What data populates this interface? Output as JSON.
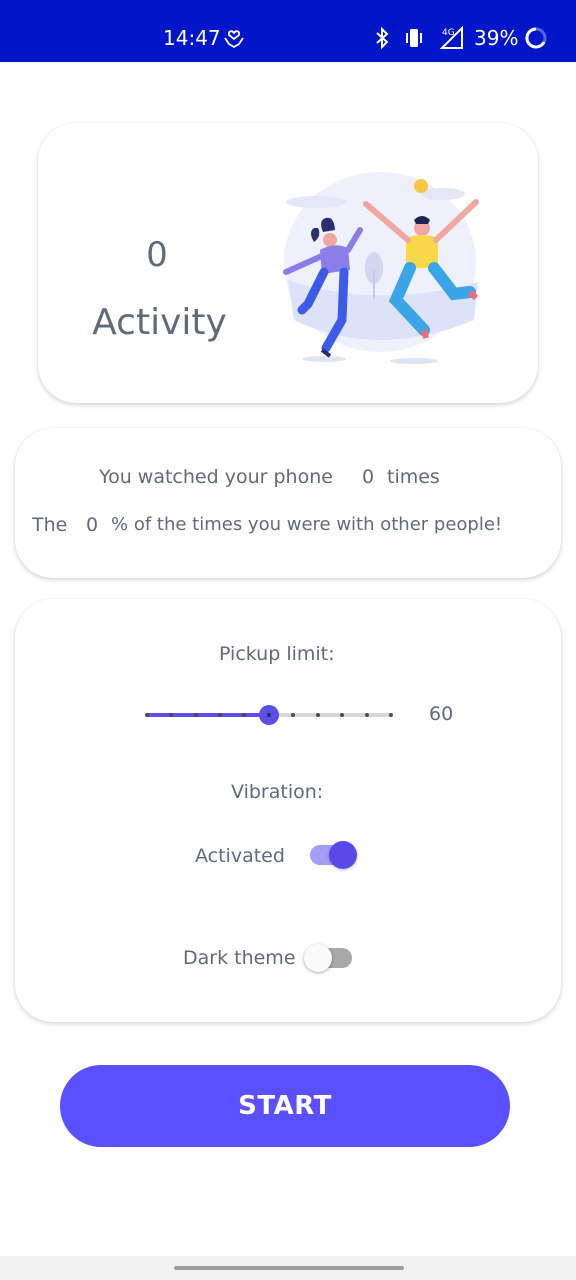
{
  "status_bar": {
    "time": "14:47",
    "battery": "39%",
    "network": "4G",
    "background_color": "#0016c8"
  },
  "activity": {
    "count": "0",
    "label": "Activity"
  },
  "stats": {
    "watched_prefix": "You watched your phone",
    "watched_count": "0",
    "watched_suffix": "times",
    "people_prefix": "The",
    "people_percent": "0",
    "people_suffix": "% of the times you were with other people!"
  },
  "settings": {
    "pickup_limit_label": "Pickup limit:",
    "pickup_limit_value": "60",
    "slider_level_fraction": 0.5,
    "vibration_label": "Vibration:",
    "vibration_toggle_label": "Activated",
    "vibration_on": true,
    "dark_theme_label": "Dark theme",
    "dark_theme_on": false
  },
  "start_button": {
    "label": "START",
    "color": "#5a50ff"
  },
  "colors": {
    "accent": "#5b4fe8",
    "text": "#5f6b7a"
  }
}
